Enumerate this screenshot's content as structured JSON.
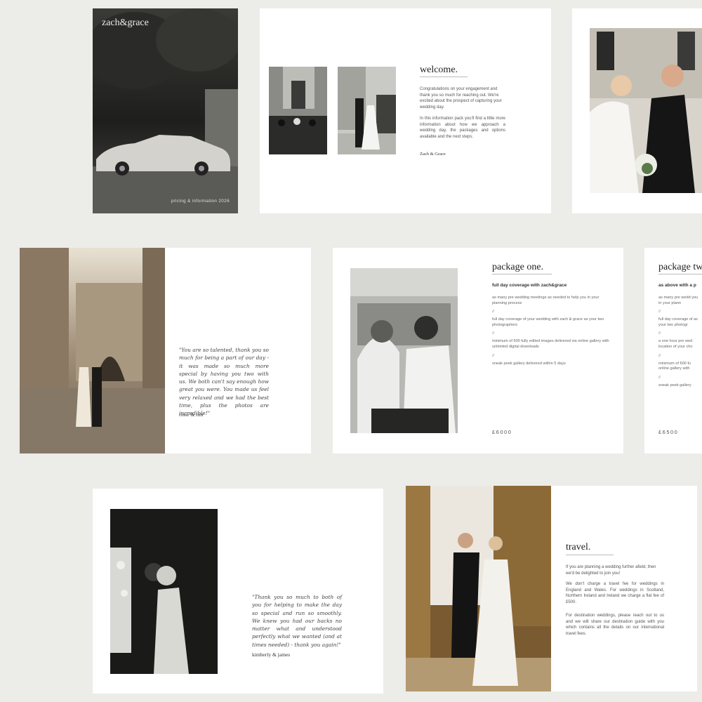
{
  "cover": {
    "title": "zach&grace",
    "subtitle": "pricing & information 2026"
  },
  "welcome": {
    "heading": "welcome.",
    "para1": "Congratulations on your engagement and thank you so much for reaching out. We're excited about the prospect of capturing your wedding day.",
    "para2": "In this information pack you'll find a little more information about how we approach a wedding day, the packages and options available and the next steps.",
    "signature": "Zach & Grace"
  },
  "testimonial1": {
    "quote": "\"You are so talented, thank you so much for being a part of our day - it was made so much more special by having you two with us. We both can't say enough how great you were. You made us feel very relaxed and we had the best time, plus the photos are incredible!\"",
    "signature": "rosie & tim"
  },
  "package_one": {
    "heading": "package one.",
    "subheading": "full day coverage with zach&grace",
    "items": [
      "as many pre wedding meetings as needed to help you in your planning process",
      "full day coverage of your wedding with zach & grace as your two photographers",
      "minimum of 600 fully edited images delivered via online gallery with unlimited digital downloads",
      "sneak peek gallery delivered within 5 days"
    ],
    "separator": "//",
    "price": "£6000"
  },
  "package_two": {
    "heading": "package two.",
    "subheading": "as above with a p",
    "items": [
      "as many pre wedd you in your plann",
      "full day coverage of as your two photogr",
      "a one hour pre wed location of your cho",
      "minimum of 600 fu online gallery with",
      "sneak peek gallery"
    ],
    "separator": "//",
    "price": "£6500"
  },
  "testimonial2": {
    "quote": "\"Thank you so much to both of you for helping to make the day so special and run so smoothly. We knew you had our backs no matter what and understood perfectly what we wanted (and at times needed) - thank you again!\"",
    "signature": "kimberly & james"
  },
  "travel": {
    "heading": "travel.",
    "para1": "If you are planning a wedding further afield, then we'd be delighted to join you!",
    "para2": "We don't charge a travel fee for weddings in England and Wales. For weddings in Scotland, Northern Ireland and Ireland we charge a flat fee of £500.",
    "para3": "For destination weddings, please reach out to us and we will share our destination guide with you which contains all the details on our international travel fees."
  }
}
